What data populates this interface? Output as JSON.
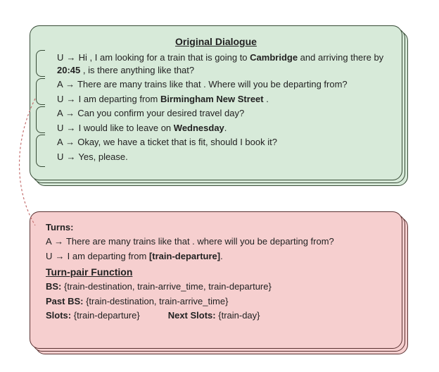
{
  "original": {
    "title": "Original Dialogue",
    "lines": [
      {
        "spk": "U",
        "pre": "Hi , I am looking for a train that is going to ",
        "b1": "Cambridge",
        "mid": " and arriving there by ",
        "b2": "20:45",
        "post": " , is there anything like that?"
      },
      {
        "spk": "A",
        "text": "There are many trains like that . Where will you be departing from?"
      },
      {
        "spk": "U",
        "pre": "I am departing from ",
        "b1": "Birmingham New Street",
        "post": " ."
      },
      {
        "spk": "A",
        "text": "Can you confirm your desired travel day?"
      },
      {
        "spk": "U",
        "pre": "I would like to leave on ",
        "b1": "Wednesday",
        "post": "."
      },
      {
        "spk": "A",
        "text": "Okay, we have a ticket that is fit, should I book it?"
      },
      {
        "spk": "U",
        "text": "Yes, please."
      }
    ]
  },
  "derived": {
    "turns_heading": "Turns:",
    "turn_a": {
      "spk": "A",
      "text": "There are many trains like that . where will you be departing from?"
    },
    "turn_u": {
      "spk": "U",
      "pre": "I am departing from ",
      "b1": "[train-departure]",
      "post": "."
    },
    "func_title": "Turn-pair Function",
    "bs_label": "BS:",
    "bs_val": "{train-destination, train-arrive_time, train-departure}",
    "pastbs_label": "Past BS:",
    "pastbs_val": "{train-destination, train-arrive_time}",
    "slots_label": "Slots:",
    "slots_val": "{train-departure}",
    "nextslots_label": "Next Slots:",
    "nextslots_val": "{train-day}"
  },
  "arrow_glyph": "→"
}
